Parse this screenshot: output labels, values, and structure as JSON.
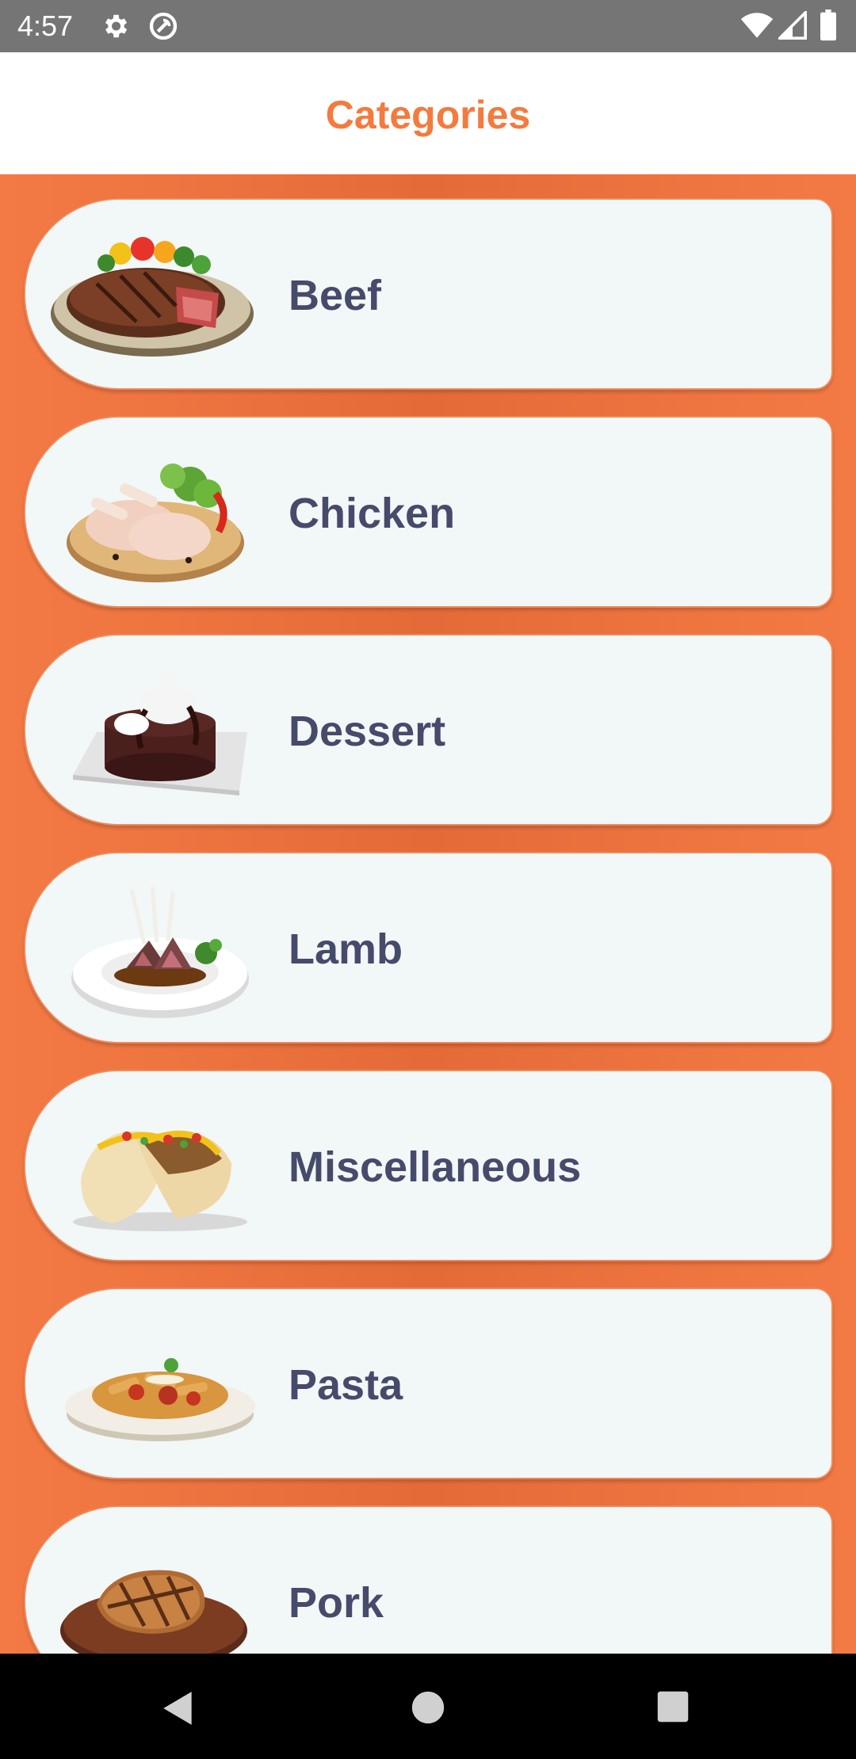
{
  "status_bar": {
    "time": "4:57",
    "icons": [
      "settings-gear-icon",
      "sync-icon",
      "wifi-icon",
      "cell-signal-icon",
      "battery-icon"
    ]
  },
  "header": {
    "title": "Categories"
  },
  "categories": [
    {
      "label": "Beef",
      "image": "beef-steak-image"
    },
    {
      "label": "Chicken",
      "image": "chicken-legs-image"
    },
    {
      "label": "Dessert",
      "image": "chocolate-lava-cake-image"
    },
    {
      "label": "Lamb",
      "image": "lamb-chops-image"
    },
    {
      "label": "Miscellaneous",
      "image": "tacos-image"
    },
    {
      "label": "Pasta",
      "image": "penne-pasta-image"
    },
    {
      "label": "Pork",
      "image": "pork-chop-image"
    }
  ],
  "nav_bar": {
    "buttons": [
      "back-icon",
      "home-icon",
      "recents-icon"
    ]
  },
  "colors": {
    "accent": "#f47a3d",
    "list_background": "#ee7342",
    "card_background": "#f2f7f8",
    "label_text": "#464a6b",
    "status_bar": "#757575",
    "nav_bar": "#000000"
  }
}
